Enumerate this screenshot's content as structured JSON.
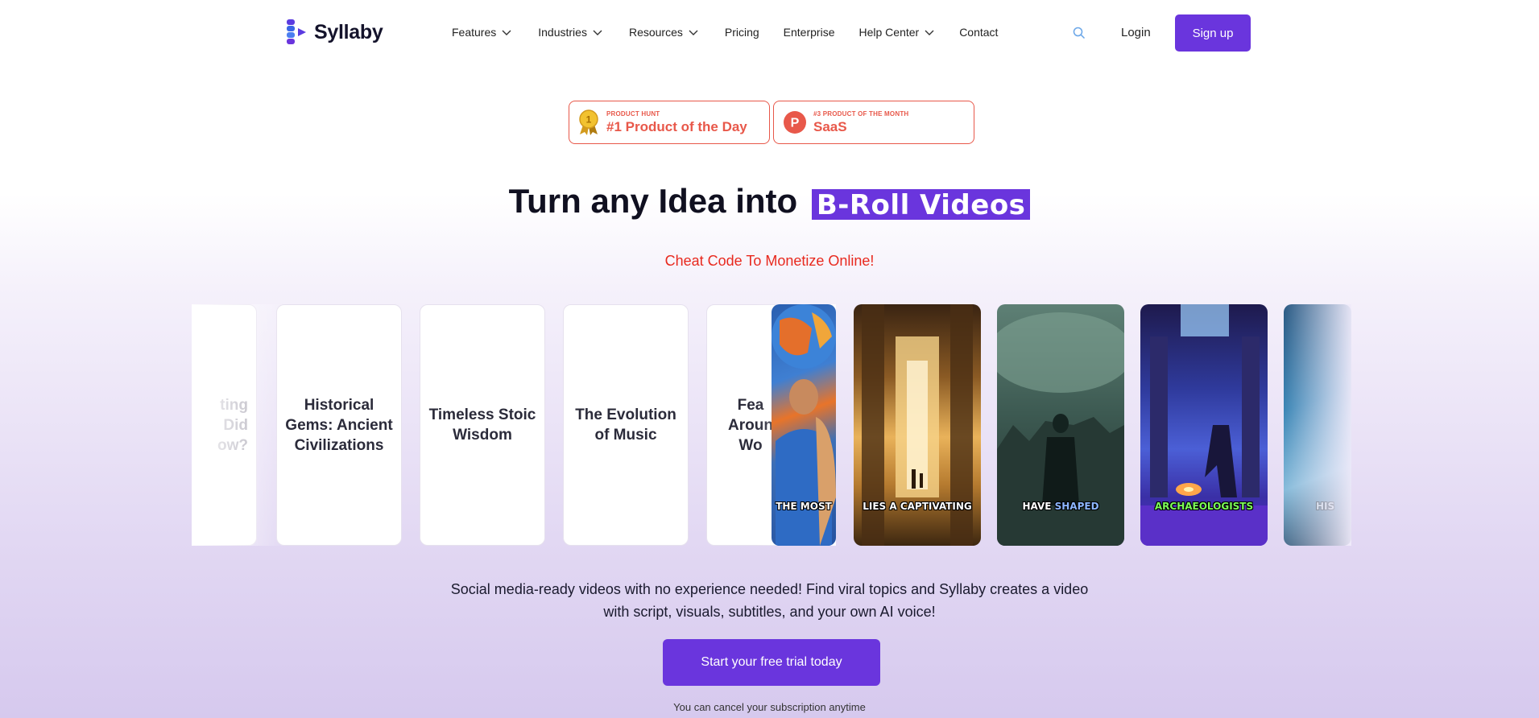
{
  "brand": {
    "name": "Syllaby",
    "accent": "#6a35dd"
  },
  "nav": {
    "items": [
      {
        "label": "Features",
        "has_dropdown": true
      },
      {
        "label": "Industries",
        "has_dropdown": true
      },
      {
        "label": "Resources",
        "has_dropdown": true
      },
      {
        "label": "Pricing",
        "has_dropdown": false
      },
      {
        "label": "Enterprise",
        "has_dropdown": false
      },
      {
        "label": "Help Center",
        "has_dropdown": true
      },
      {
        "label": "Contact",
        "has_dropdown": false
      }
    ],
    "search_icon": "search-icon",
    "login_label": "Login",
    "signup_label": "Sign up"
  },
  "badges": [
    {
      "small": "PRODUCT HUNT",
      "big": "#1 Product of the Day",
      "icon": "medal-icon",
      "medal_number": "1",
      "color": "#e8584a"
    },
    {
      "small": "#3 PRODUCT OF THE MONTH",
      "big": "SaaS",
      "icon": "product-hunt-icon",
      "icon_letter": "P",
      "color": "#e8584a"
    }
  ],
  "hero": {
    "headline": "Turn any Idea into",
    "highlight": "B-Roll Videos",
    "tagline": "Cheat Code To Monetize Online!",
    "tagline_color": "#e8291e"
  },
  "carousel": {
    "topic_cards": [
      {
        "title": "ting\nDid\now?"
      },
      {
        "title": "Historical Gems: Ancient Civilizations"
      },
      {
        "title": "Timeless Stoic Wisdom"
      },
      {
        "title": "The Evolution of Music"
      },
      {
        "title": "Fea\nAroun\nWo"
      }
    ],
    "video_cards": [
      {
        "caption": "THE MOST",
        "caption_highlight": "",
        "theme": "people-globe"
      },
      {
        "caption": "LIES A CAPTIVATING",
        "caption_highlight": "",
        "theme": "temple-corridor"
      },
      {
        "caption": "HAVE",
        "caption_highlight": "SHAPED",
        "theme": "misty-army"
      },
      {
        "caption": "",
        "caption_highlight": "ARCHAEOLOGISTS",
        "theme": "ancient-ruins"
      },
      {
        "caption": "HIS",
        "caption_highlight": "",
        "theme": "ocean-partial"
      }
    ]
  },
  "cta": {
    "description_line1": "Social media-ready videos with no experience needed! Find viral topics and Syllaby creates a video",
    "description_line2": "with script, visuals, subtitles, and your own AI voice!",
    "button_label": "Start your free trial today",
    "note": "You can cancel your subscription anytime"
  }
}
